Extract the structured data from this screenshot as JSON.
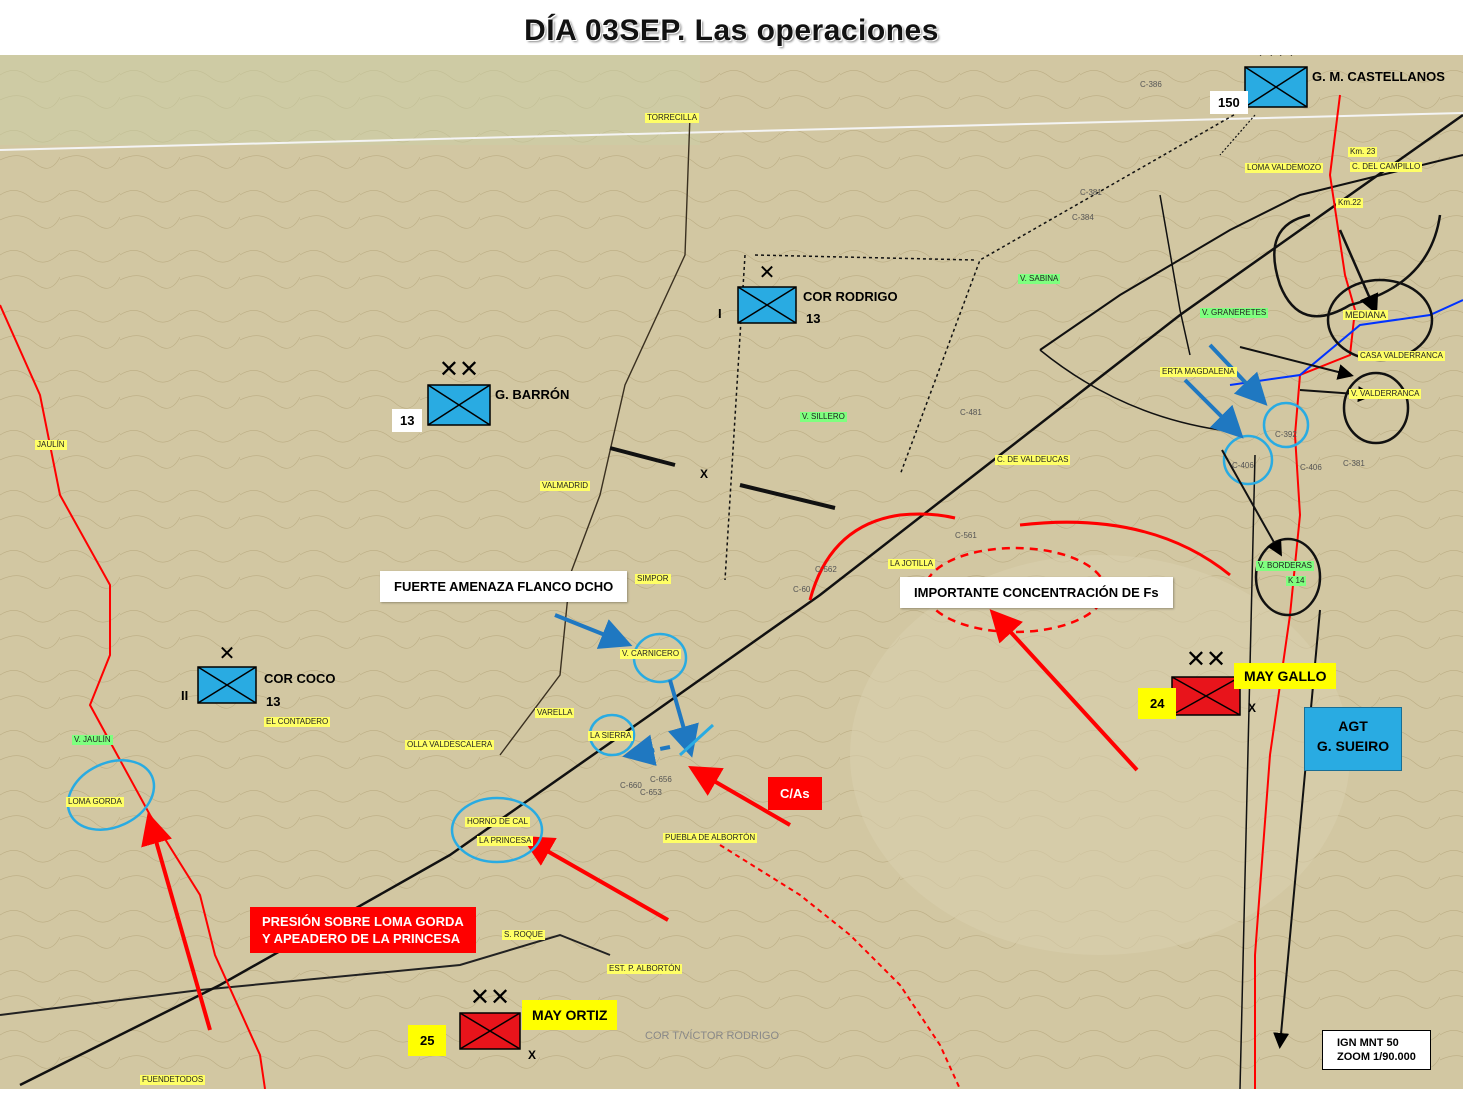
{
  "title": "DÍA 03SEP. Las operaciones",
  "units": {
    "castellanos": {
      "name": "G. M. CASTELLANOS",
      "number": "150",
      "size": "XX",
      "side": "blue"
    },
    "rodrigo": {
      "name": "COR RODRIGO",
      "number": "13",
      "prefix": "I",
      "size": "X",
      "side": "blue"
    },
    "barron": {
      "name": "G. BARRÓN",
      "number": "13",
      "size": "XX",
      "side": "blue"
    },
    "coco": {
      "name": "COR COCO",
      "number": "13",
      "prefix": "II",
      "size": "X",
      "side": "blue"
    },
    "gallo": {
      "name": "MAY GALLO",
      "number": "24",
      "suffix": "X",
      "size": "XX",
      "side": "red"
    },
    "ortiz": {
      "name": "MAY  ORTIZ",
      "number": "25",
      "suffix": "X",
      "size": "XX",
      "side": "red"
    }
  },
  "annotations": {
    "fuerte_amenaza": "FUERTE AMENAZA FLANCO DCHO",
    "concentracion": "IMPORTANTE CONCENTRACIÓN DE Fs",
    "cas": "C/As",
    "presion_line1": "PRESIÓN SOBRE LOMA GORDA",
    "presion_line2": "Y APEADERO DE LA PRINCESA",
    "agt_line1": "AGT",
    "agt_line2": "G. SUEIRO",
    "boundary_x": "X",
    "scale_line1": "IGN MNT 50",
    "scale_line2": "ZOOM 1/90.000"
  },
  "places": {
    "torrecilla": "TORRECILLA",
    "loma_valdemozo": "LOMA VALDEMOZO",
    "del_campillo": "C. DEL CAMPILLO",
    "km23": "Km. 23",
    "km22": "Km.22",
    "c386": "C-386",
    "c381a": "C-381",
    "c384": "C-384",
    "v_sabina": "V. SABINA",
    "v_granaretes": "V. GRANERETES",
    "mediana": "MEDIANA",
    "cas_valderranca": "CASA VALDERRANCA",
    "v_valderranca": "V. VALDERRANCA",
    "erta_magdalena": "ERTA MAGDALENA",
    "c392": "C-392",
    "c406a": "C-406",
    "c406b": "C-406",
    "c381b": "C-381",
    "c481": "C-481",
    "v_sillero": "V. SILLERO",
    "c_valdeucas": "C. DE VALDEUCAS",
    "valmadrid": "VALMADRID",
    "jaulin": "JAULÍN",
    "c561": "C-561",
    "la_jotilla": "LA JOTILLA",
    "c562": "C-562",
    "c60": "C-60",
    "simpor": "SIMPOR",
    "borderas": "V. BORDERAS",
    "k14": "K 14",
    "v_carnicero": "V. CARNICERO",
    "varella": "VARELLA",
    "la_sierra": "LA SIERRA",
    "c660": "C-660",
    "c656": "C-656",
    "c653": "C-653",
    "contadero": "EL CONTADERO",
    "v_jaulin": "V. JAULÍN",
    "olla_valdescalera": "OLLA VALDESCALERA",
    "loma_gorda": "LOMA GORDA",
    "horno_cal": "HORNO DE CAL",
    "la_princesa": "LA PRINCESA",
    "puebla": "PUEBLA DE ALBORTÓN",
    "roque": "S. ROQUE",
    "est_alborton": "EST. P. ALBORTÓN",
    "cor_victor": "COR T/VÍCTOR RODRIGO",
    "fuendetodos": "FUENDETODOS"
  },
  "colors": {
    "blue_unit": "#29abe2",
    "red_unit": "#e8141b",
    "map_bg": "#d2c7a2",
    "yellow": "#ffff00"
  }
}
